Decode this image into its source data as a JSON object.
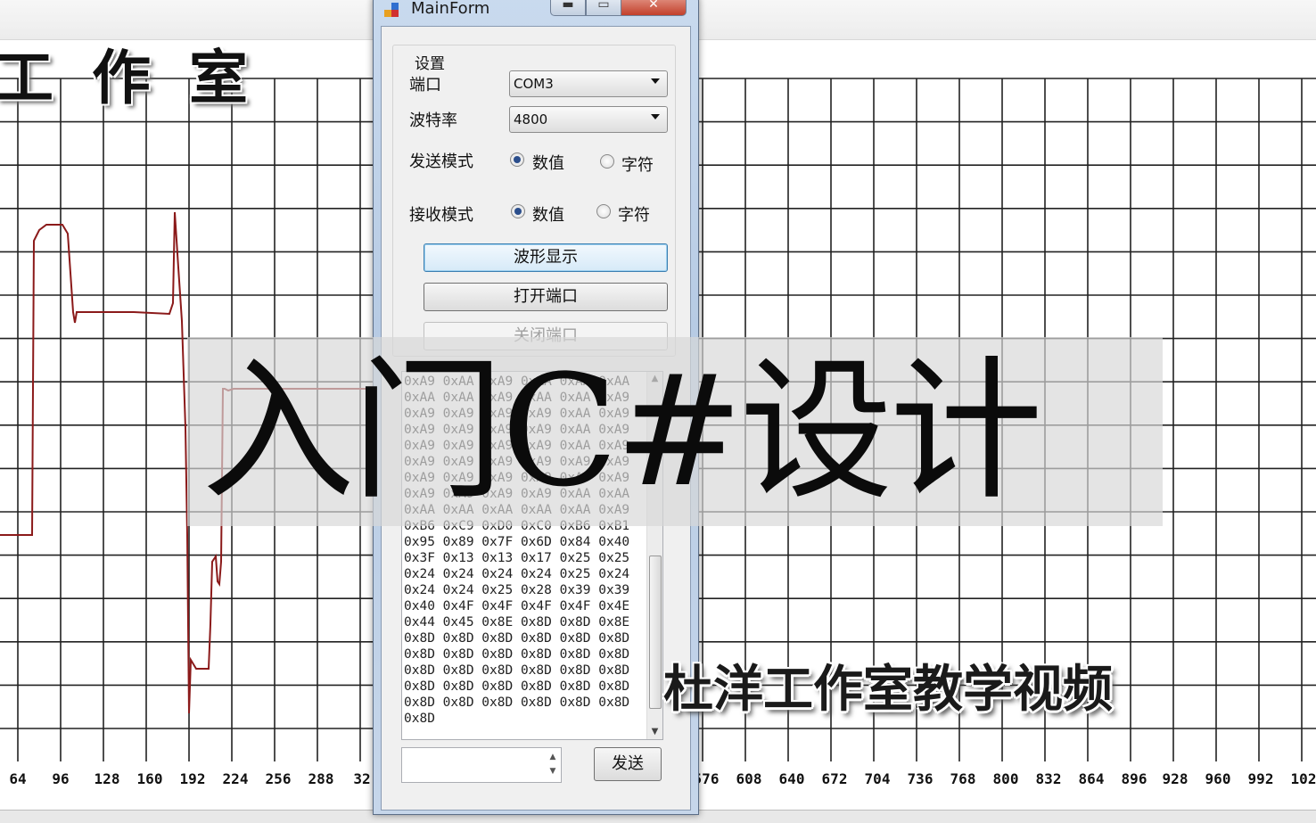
{
  "background": {
    "studio_title": "工 作 室",
    "x_axis_ticks": [
      "64",
      "96",
      "128",
      "160",
      "192",
      "224",
      "256",
      "288",
      "32",
      "576",
      "608",
      "640",
      "672",
      "704",
      "736",
      "768",
      "800",
      "832",
      "864",
      "896",
      "928",
      "960",
      "992",
      "102"
    ],
    "wave_color": "#8b1a1a"
  },
  "window": {
    "title": "MainForm",
    "minimize_glyph": "▬",
    "maximize_glyph": "▭",
    "close_glyph": "✕"
  },
  "settings": {
    "group_title": "设置",
    "port_label": "端口",
    "port_value": "COM3",
    "baud_label": "波特率",
    "baud_value": "4800",
    "send_mode_label": "发送模式",
    "send_mode_numeric": "数值",
    "send_mode_text": "字符",
    "send_mode_selected": "数值",
    "recv_mode_label": "接收模式",
    "recv_mode_numeric": "数值",
    "recv_mode_text": "字符",
    "recv_mode_selected": "数值",
    "waveform_button": "波形显示",
    "open_port_button": "打开端口",
    "close_port_button": "关闭端口"
  },
  "receive_box": {
    "lines": [
      "0xA9 0xAA 0xA9 0xAA 0xAA 0xAA",
      "0xAA 0xAA 0xA9 0xAA 0xAA 0xA9",
      "0xA9 0xA9 0xA9 0xA9 0xAA 0xA9",
      "0xA9 0xA9 0xA9 0xA9 0xAA 0xA9",
      "0xA9 0xA9 0xA9 0xA9 0xAA 0xA9",
      "0xA9 0xA9 0xA9 0xA9 0xA9 0xA9",
      "0xA9 0xA9 0xA9 0xA9 0xA9 0xA9",
      "0xA9 0xA9 0xA9 0xA9 0xAA 0xAA",
      "0xAA 0xAA 0xAA 0xAA 0xAA 0xA9",
      "0xB6 0xC9 0xD0 0xC0 0xB6 0xB1",
      "0x95 0x89 0x7F 0x6D 0x84 0x40",
      "0x3F 0x13 0x13 0x17 0x25 0x25",
      "0x24 0x24 0x24 0x24 0x25 0x24",
      "0x24 0x24 0x25 0x28 0x39 0x39",
      "0x40 0x4F 0x4F 0x4F 0x4F 0x4E",
      "0x44 0x45 0x8E 0x8D 0x8D 0x8E",
      "0x8D 0x8D 0x8D 0x8D 0x8D 0x8D",
      "0x8D 0x8D 0x8D 0x8D 0x8D 0x8D",
      "0x8D 0x8D 0x8D 0x8D 0x8D 0x8D",
      "0x8D 0x8D 0x8D 0x8D 0x8D 0x8D",
      "0x8D 0x8D 0x8D 0x8D 0x8D 0x8D",
      "0x8D"
    ]
  },
  "send": {
    "input_value": "",
    "spin_up": "▲",
    "spin_down": "▼",
    "send_button": "发送"
  },
  "overlay": {
    "banner_text": "入门C#设计",
    "caption": "杜洋工作室教学视频"
  },
  "colors": {
    "accent_focus": "#3c7fb1",
    "radio_dot": "#2b4e8c"
  }
}
